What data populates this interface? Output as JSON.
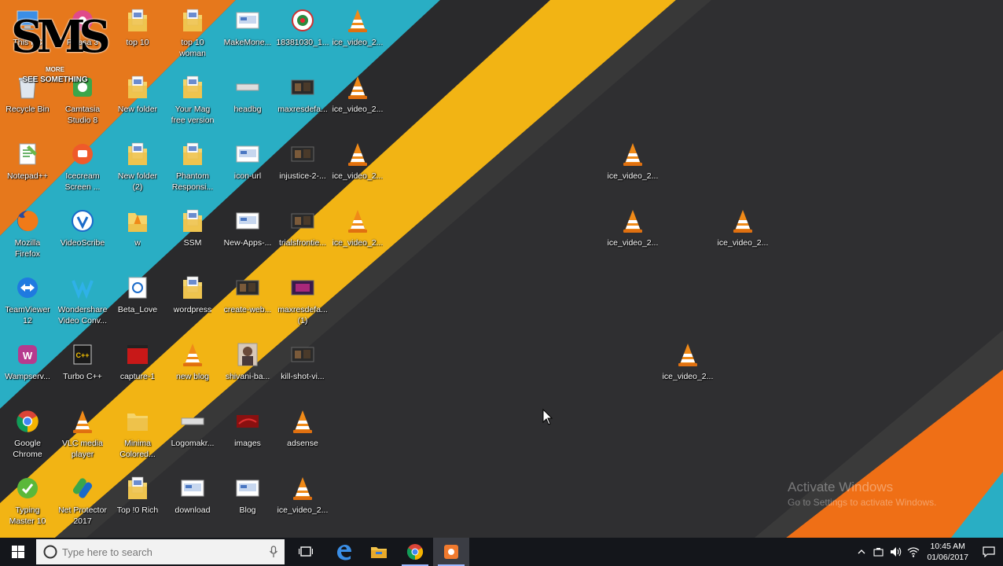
{
  "desktop": {
    "watermark": {
      "letters": "SMS",
      "more": "MORE",
      "subtitle": "SEE SOMETHING"
    },
    "icons": [
      {
        "label": "This PC",
        "icon": "computer",
        "col": 0,
        "row": 0
      },
      {
        "label": "Recycle Bin",
        "icon": "recycle-bin",
        "col": 0,
        "row": 1
      },
      {
        "label": "Notepad++",
        "icon": "notepad",
        "col": 0,
        "row": 2
      },
      {
        "label": "Mozilla\nFirefox",
        "icon": "firefox",
        "col": 0,
        "row": 3
      },
      {
        "label": "TeamViewer\n12",
        "icon": "teamviewer",
        "col": 0,
        "row": 4
      },
      {
        "label": "Wampserv...",
        "icon": "wamp",
        "col": 0,
        "row": 5
      },
      {
        "label": "Google\nChrome",
        "icon": "chrome",
        "col": 0,
        "row": 6
      },
      {
        "label": "Typing\nMaster 10",
        "icon": "typing-master",
        "col": 0,
        "row": 7
      },
      {
        "label": "Picasa 3",
        "icon": "picasa",
        "col": 1,
        "row": 0
      },
      {
        "label": "Camtasia\nStudio 8",
        "icon": "camtasia",
        "col": 1,
        "row": 1
      },
      {
        "label": "Icecream\nScreen ...",
        "icon": "icecream",
        "col": 1,
        "row": 2
      },
      {
        "label": "VideoScribe",
        "icon": "videoscribe",
        "col": 1,
        "row": 3
      },
      {
        "label": "Wondershare\nVideo Conv...",
        "icon": "wondershare",
        "col": 1,
        "row": 4
      },
      {
        "label": "Turbo C++",
        "icon": "turbo",
        "col": 1,
        "row": 5
      },
      {
        "label": "VLC media\nplayer",
        "icon": "vlc",
        "col": 1,
        "row": 6
      },
      {
        "label": "Net Protector\n2017",
        "icon": "net-protector",
        "col": 1,
        "row": 7
      },
      {
        "label": "top 10",
        "icon": "folder-doc",
        "col": 2,
        "row": 0
      },
      {
        "label": "New folder",
        "icon": "folder-doc",
        "col": 2,
        "row": 1
      },
      {
        "label": "New folder\n(2)",
        "icon": "folder-doc",
        "col": 2,
        "row": 2
      },
      {
        "label": "w",
        "icon": "folder-vlc",
        "col": 2,
        "row": 3
      },
      {
        "label": "Beta_Love",
        "icon": "beta",
        "col": 2,
        "row": 4
      },
      {
        "label": "capture-1",
        "icon": "capture",
        "col": 2,
        "row": 5
      },
      {
        "label": "Minima\nColored...",
        "icon": "folder",
        "col": 2,
        "row": 6
      },
      {
        "label": "Top !0 Rich",
        "icon": "folder-doc",
        "col": 2,
        "row": 7
      },
      {
        "label": "top 10\nwoman",
        "icon": "folder-doc",
        "col": 3,
        "row": 0
      },
      {
        "label": "Your Mag\nfree version",
        "icon": "folder-doc",
        "col": 3,
        "row": 1
      },
      {
        "label": "Phantom\nResponsi...",
        "icon": "folder-doc",
        "col": 3,
        "row": 2
      },
      {
        "label": "SSM",
        "icon": "folder-doc",
        "col": 3,
        "row": 3
      },
      {
        "label": "wordpress",
        "icon": "folder-doc",
        "col": 3,
        "row": 4
      },
      {
        "label": "new blog",
        "icon": "vlc",
        "col": 3,
        "row": 5
      },
      {
        "label": "Logomakr...",
        "icon": "image-thin",
        "col": 3,
        "row": 6
      },
      {
        "label": "download",
        "icon": "image",
        "col": 3,
        "row": 7
      },
      {
        "label": "MakeMone...",
        "icon": "image",
        "col": 4,
        "row": 0
      },
      {
        "label": "headbg",
        "icon": "image-thin",
        "col": 4,
        "row": 1
      },
      {
        "label": "icon-url",
        "icon": "image",
        "col": 4,
        "row": 2
      },
      {
        "label": "New-Apps-...",
        "icon": "image",
        "col": 4,
        "row": 3
      },
      {
        "label": "create-web...",
        "icon": "image-dark",
        "col": 4,
        "row": 4
      },
      {
        "label": "shivani-ba...",
        "icon": "photo",
        "col": 4,
        "row": 5
      },
      {
        "label": "images",
        "icon": "image-red",
        "col": 4,
        "row": 6
      },
      {
        "label": "Blog",
        "icon": "image",
        "col": 4,
        "row": 7
      },
      {
        "label": "18381030_1...",
        "icon": "badge",
        "col": 5,
        "row": 0
      },
      {
        "label": "maxresdefa...",
        "icon": "image-dark",
        "col": 5,
        "row": 1
      },
      {
        "label": "injustice-2-...",
        "icon": "image-dark",
        "col": 5,
        "row": 2
      },
      {
        "label": "trialsfrontie...",
        "icon": "image-dark",
        "col": 5,
        "row": 3
      },
      {
        "label": "maxresdefa...\n(1)",
        "icon": "image-purple",
        "col": 5,
        "row": 4
      },
      {
        "label": "kill-shot-vi...",
        "icon": "image-dark",
        "col": 5,
        "row": 5
      },
      {
        "label": "adsense",
        "icon": "vlc",
        "col": 5,
        "row": 6
      },
      {
        "label": "ice_video_2...",
        "icon": "vlc",
        "col": 5,
        "row": 7
      },
      {
        "label": "ice_video_2...",
        "icon": "vlc",
        "col": 6,
        "row": 0
      },
      {
        "label": "ice_video_2...",
        "icon": "vlc",
        "col": 6,
        "row": 1
      },
      {
        "label": "ice_video_2...",
        "icon": "vlc",
        "col": 6,
        "row": 2
      },
      {
        "label": "ice_video_2...",
        "icon": "vlc",
        "col": 6,
        "row": 3
      },
      {
        "label": "ice_video_2...",
        "icon": "vlc",
        "col": 11,
        "row": 2
      },
      {
        "label": "ice_video_2...",
        "icon": "vlc",
        "col": 11,
        "row": 3
      },
      {
        "label": "ice_video_2...",
        "icon": "vlc",
        "col": 13,
        "row": 3
      },
      {
        "label": "ice_video_2...",
        "icon": "vlc",
        "col": 12,
        "row": 5
      }
    ],
    "activation": {
      "title": "Activate Windows",
      "subtitle": "Go to Settings to activate Windows."
    }
  },
  "taskbar": {
    "search_placeholder": "Type here to search",
    "pinned": [
      {
        "name": "task-view",
        "icon": "task-view-icon"
      },
      {
        "name": "edge",
        "icon": "edge-icon"
      },
      {
        "name": "file-explorer",
        "icon": "folder-icon"
      },
      {
        "name": "chrome",
        "icon": "chrome-icon"
      },
      {
        "name": "recorder",
        "icon": "recorder-icon",
        "active": true
      }
    ],
    "clock": {
      "time": "10:45 AM",
      "date": "01/06/2017"
    }
  },
  "colors": {
    "taskbar": "#14161b",
    "accent": "#9bb8ff"
  }
}
